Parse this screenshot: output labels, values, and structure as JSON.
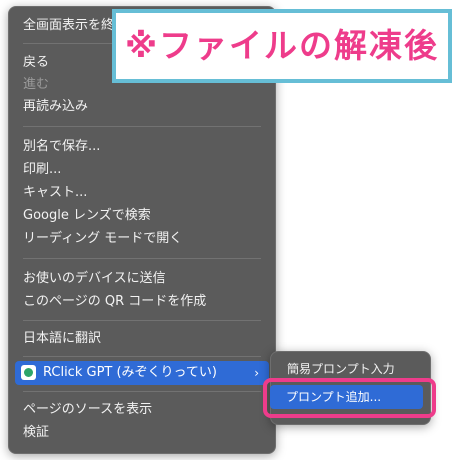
{
  "context_menu": {
    "items": [
      {
        "label": "全画面表示を終了",
        "disabled": false
      },
      {
        "label": "戻る",
        "disabled": false
      },
      {
        "label": "進む",
        "disabled": true
      },
      {
        "label": "再読み込み",
        "disabled": false
      },
      {
        "label": "別名で保存...",
        "disabled": false
      },
      {
        "label": "印刷...",
        "disabled": false
      },
      {
        "label": "キャスト...",
        "disabled": false
      },
      {
        "label": "Google レンズで検索",
        "disabled": false
      },
      {
        "label": "リーディング モードで開く",
        "disabled": false
      },
      {
        "label": "お使いのデバイスに送信",
        "disabled": false
      },
      {
        "label": "このページの QR コードを作成",
        "disabled": false
      },
      {
        "label": "日本語に翻訳",
        "disabled": false
      },
      {
        "label": "RClick GPT (みぞくりってい)",
        "disabled": false,
        "highlighted": true,
        "icon": "extension-icon",
        "has_submenu": true
      },
      {
        "label": "ページのソースを表示",
        "disabled": false
      },
      {
        "label": "検証",
        "disabled": false
      }
    ],
    "chevron": "›"
  },
  "submenu": {
    "items": [
      {
        "label": "簡易プロンプト入力"
      },
      {
        "label": "プロンプト追加...",
        "highlighted": true
      }
    ]
  },
  "annotation": {
    "text": "※ファイルの解凍後",
    "text_color": "#ee3c8b",
    "border_color": "#66bed6"
  },
  "colors": {
    "menu_bg": "#5b5b5b",
    "highlight": "#2f6bd6",
    "callout_border": "#ee3c8b"
  }
}
